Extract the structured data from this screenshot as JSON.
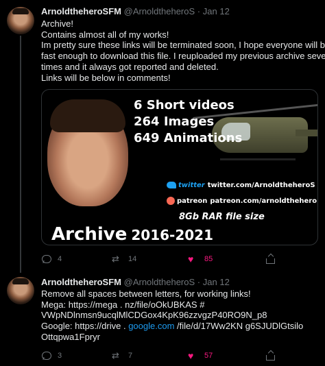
{
  "tweets": [
    {
      "name": "ArnoldtheheroSFM",
      "handle": "@ArnoldtheheroS",
      "separator": "·",
      "date": "Jan 12",
      "lines": [
        "Archive!",
        "Contains almost all of my works!",
        "Im pretty sure these links will be terminated soon, I hope everyone will be",
        "fast enough to download this file. I reuploaded my previous archive several",
        "times and it always got reported and deleted.",
        "Links will be below in comments!"
      ],
      "media": {
        "line1": "6 Short videos",
        "line2": "264 Images",
        "line3": "649 Animations",
        "twitter_brand": "twitter",
        "twitter_url": "twitter.com/ArnoldtheheroS",
        "patreon_brand": "patreon",
        "patreon_url": "patreon.com/arnoldthehero",
        "size": "8Gb RAR file size",
        "archive": "Archive",
        "years": "2016-2021"
      },
      "replies": "4",
      "retweets": "14",
      "likes": "85"
    },
    {
      "name": "ArnoldtheheroSFM",
      "handle": "@ArnoldtheheroS",
      "separator": "·",
      "date": "Jan 12",
      "line1": "Remove all spaces between letters, for working links!",
      "line2": "Mega: https://mega . nz/file/oOkUBKAS #",
      "line3": "VWpNDlnmsn9ucqlMlCDGox4KpK96zzvgzP40RO9N_p8",
      "line4_prefix": "Google: https://drive . ",
      "line4_link": "google.com",
      "line4_suffix": " /file/d/17Ww2KN g6SJUDlGtsilo",
      "line5": "Ottqpwa1Fpryr",
      "replies": "3",
      "retweets": "7",
      "likes": "57"
    }
  ],
  "colors": {
    "background": "#000000",
    "text": "#e7e9ea",
    "muted": "#71767b",
    "link": "#1d9bf0",
    "like": "#f91880"
  },
  "icons": [
    "reply-icon",
    "retweet-icon",
    "heart-icon",
    "share-icon",
    "twitter-bird-icon",
    "patreon-icon"
  ]
}
